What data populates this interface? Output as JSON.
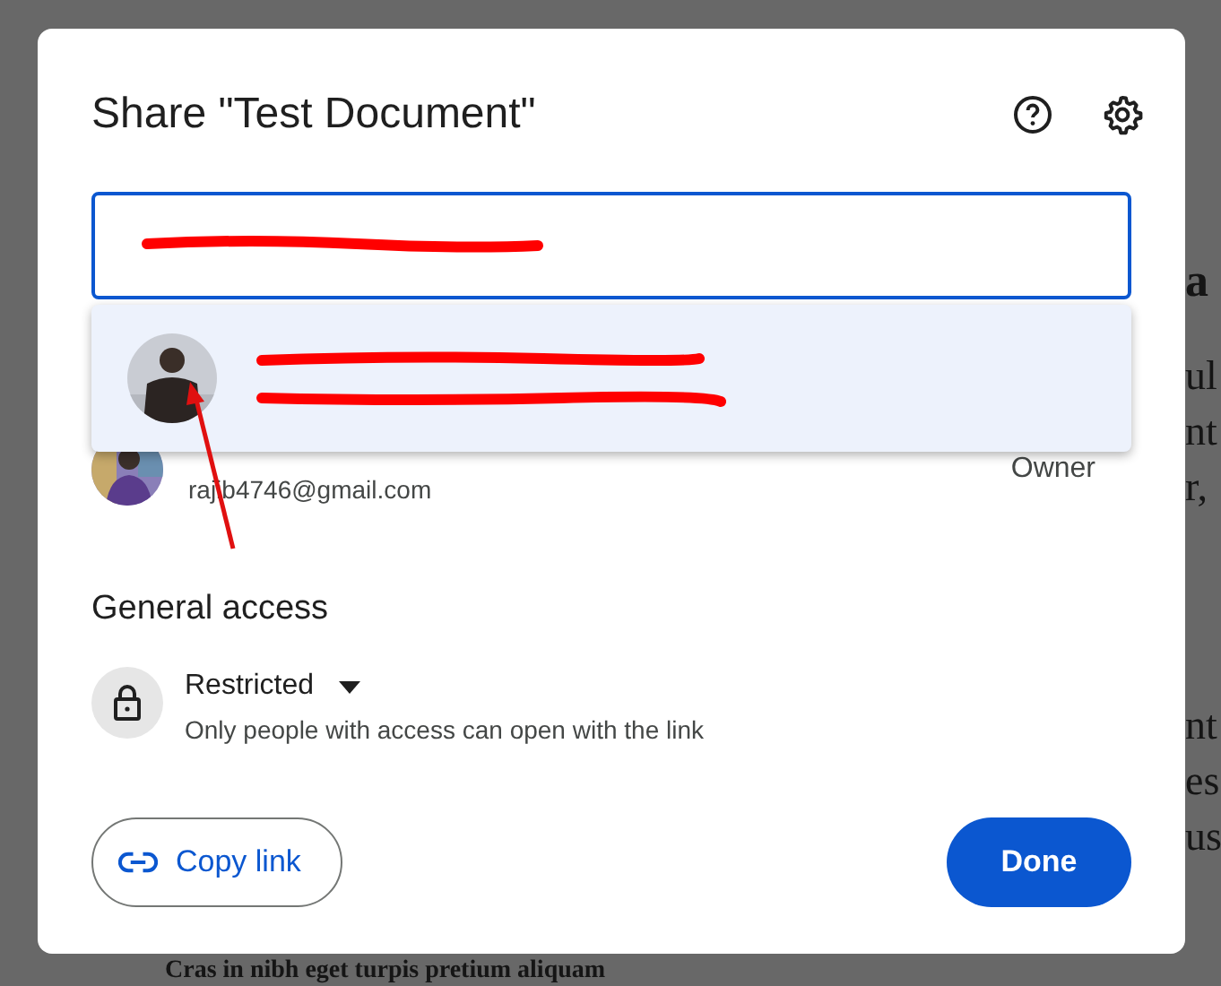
{
  "background_document": {
    "heading": "a",
    "paragraphs": [
      [
        "ul",
        "nt",
        "r,"
      ],
      [
        "nt",
        "es",
        "us"
      ]
    ],
    "footer_heading": "Cras in nibh eget turpis pretium aliquam"
  },
  "dialog": {
    "title": "Share \"Test Document\"",
    "recipient_field": {
      "focused": true,
      "marks": [
        {
          "kind": "redaction"
        }
      ]
    },
    "suggestions": [
      {
        "avatar": {
          "kind": "picture"
        },
        "lines": [
          {
            "kind": "redaction"
          },
          {
            "kind": "redaction"
          }
        ],
        "highlighted": true
      }
    ],
    "people": [
      {
        "avatar": {
          "kind": "picture"
        },
        "email": "rajib4746@gmail.com",
        "role": "Owner"
      }
    ],
    "general_access": {
      "heading": "General access",
      "level_label": "Restricted",
      "description": "Only people with access can open with the link"
    },
    "buttons": [
      {
        "kind": "outlined",
        "label": "Copy link"
      },
      {
        "kind": "filled",
        "label": "Done"
      }
    ],
    "annotations": [
      {
        "kind": "arrow"
      }
    ]
  }
}
